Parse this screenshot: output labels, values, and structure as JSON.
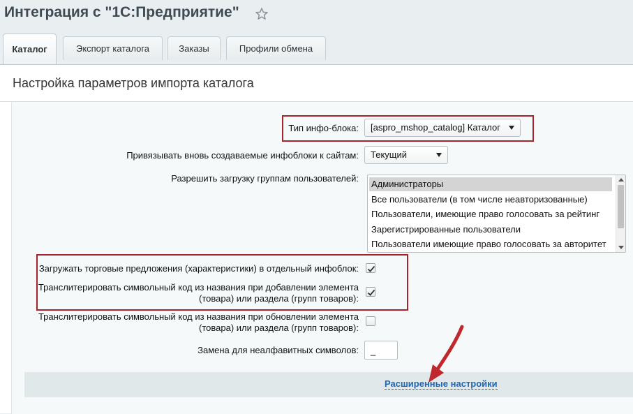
{
  "header": {
    "title": "Интеграция с \"1С:Предприятие\"",
    "star_icon": "star-outline-icon"
  },
  "tabs": [
    {
      "label": "Каталог",
      "active": true
    },
    {
      "label": "Экспорт каталога",
      "active": false
    },
    {
      "label": "Заказы",
      "active": false
    },
    {
      "label": "Профили обмена",
      "active": false
    }
  ],
  "section": {
    "title": "Настройка параметров импорта каталога"
  },
  "form": {
    "iblock_type": {
      "label": "Тип инфо-блока:",
      "value": "[aspro_mshop_catalog] Каталог"
    },
    "bind_sites": {
      "label": "Привязывать вновь создаваемые инфоблоки к сайтам:",
      "value": "Текущий"
    },
    "user_groups": {
      "label": "Разрешить загрузку группам пользователей:",
      "options": [
        "Администраторы",
        "Все пользователи (в том числе неавторизованные)",
        "Пользователи, имеющие право голосовать за рейтинг",
        "Зарегистрированные пользователи",
        "Пользователи имеющие право голосовать за авторитет"
      ],
      "selected": "Администраторы"
    },
    "offers_separate": {
      "label": "Загружать торговые предложения (характеристики) в отдельный инфоблок:",
      "checked": true
    },
    "translit_add": {
      "label_line1": "Транслитерировать символьный код из названия при добавлении элемента",
      "label_line2": "(товара) или раздела (групп товаров):",
      "checked": true
    },
    "translit_update": {
      "label_line1": "Транслитерировать символьный код из названия при обновлении элемента",
      "label_line2": "(товара) или раздела (групп товаров):",
      "checked": false
    },
    "replace_char": {
      "label": "Замена для неалфавитных символов:",
      "value": "_"
    }
  },
  "advanced_link": {
    "label": "Расширенные настройки"
  },
  "colors": {
    "highlight": "#a5232a",
    "link": "#2067b0",
    "title": "#3f4b54"
  }
}
